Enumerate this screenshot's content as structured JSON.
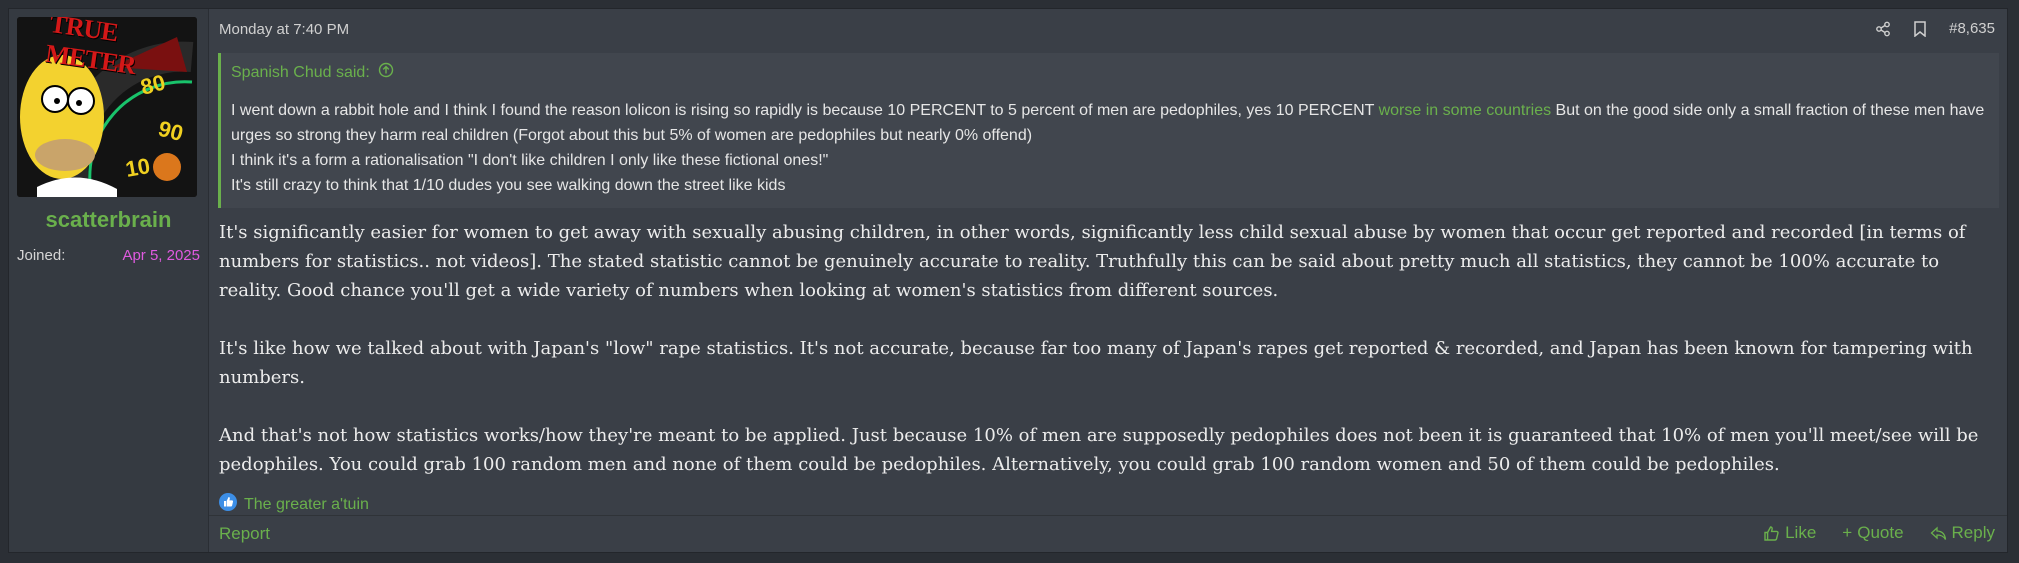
{
  "user": {
    "username": "scatterbrain",
    "joined_label": "Joined:",
    "joined_date": "Apr 5, 2025",
    "avatar_text": "TRUE METER"
  },
  "meta": {
    "date": "Monday at 7:40 PM",
    "post_number": "#8,635"
  },
  "quote": {
    "author": "Spanish Chud said:",
    "line1_a": "I went down a rabbit hole and I think I found the reason lolicon is rising so rapidly is because 10 PERCENT to 5 percent of men are pedophiles, yes 10 PERCENT ",
    "line1_link": "worse in some countries",
    "line1_b": " But on the good side only a small fraction of these men have urges so strong they harm real children (Forgot about this but 5% of women are pedophiles but nearly 0% offend)",
    "line2": "I think it's a form a rationalisation \"I don't like children I only like these fictional ones!\"",
    "line3": "It's still crazy to think that 1/10 dudes you see walking down the street like kids"
  },
  "body": {
    "p1": "It's significantly easier for women to get away with sexually abusing children, in other words, significantly less child sexual abuse by women that occur get reported and recorded [in terms of numbers for statistics.. not videos]. The stated statistic cannot be genuinely accurate to reality. Truthfully this can be said about pretty much all statistics, they cannot be 100% accurate to reality. Good chance you'll get a wide variety of numbers when looking at women's statistics from different sources.",
    "p2": "It's like how we talked about with Japan's \"low\" rape statistics. It's not accurate, because far too many of Japan's rapes get reported & recorded, and Japan has been known for tampering with numbers.",
    "p3": "And that's not how statistics works/how they're meant to be applied. Just because 10% of men are supposedly pedophiles does not been it is guaranteed that 10% of men you'll meet/see will be pedophiles. You could grab 100 random men and none of them could be pedophiles. Alternatively, you could grab 100 random women and 50 of them could be pedophiles."
  },
  "reactions": {
    "icon": "like-icon",
    "users": "The greater a'tuin"
  },
  "footer": {
    "report": "Report",
    "like": "Like",
    "quote": "Quote",
    "reply": "Reply"
  },
  "colors": {
    "accent": "#6ab04c",
    "joined_date": "#e05ae0",
    "background": "#3a3f47"
  }
}
